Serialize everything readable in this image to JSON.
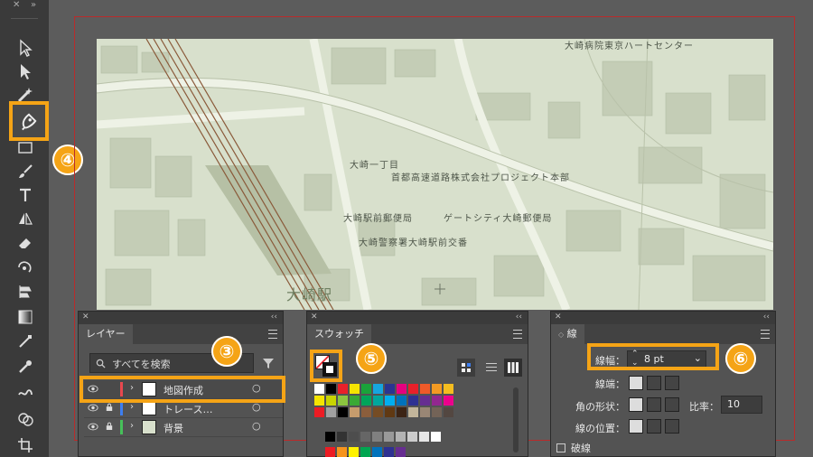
{
  "toolbar": {
    "close": "✕",
    "collapse": "»",
    "badge": "④"
  },
  "map": {
    "labels": [
      "大崎病院東京ハートセンター",
      "大崎一丁目",
      "首都高速道路株式会社プロジェクト本部",
      "大崎駅前郵便局",
      "ゲートシティ大崎郵便局",
      "大崎警察署大崎駅前交番"
    ],
    "station": "大崎駅",
    "colors": {
      "bg": "#d8e0cc",
      "block": "#c4cdb6",
      "road": "#eef2e6",
      "rail": "#8a5a3a"
    }
  },
  "layers": {
    "header_close": "✕",
    "header_collapse": "‹‹",
    "tab": "レイヤー",
    "search_placeholder": "すべてを検索",
    "badge": "③",
    "rows": [
      {
        "name": "地図作成",
        "color": "#e8484e"
      },
      {
        "name": "トレース…",
        "color": "#3d7ef0"
      },
      {
        "name": "背景",
        "color": "#46c05a"
      }
    ]
  },
  "swatches": {
    "header_close": "✕",
    "header_collapse": "‹‹",
    "tab": "スウォッチ",
    "badge": "⑤",
    "row1": [
      "#ffffff",
      "#000000",
      "#e8202a",
      "#f5e400",
      "#1aa33a",
      "#16a6df",
      "#2b3490",
      "#e5007f",
      "#e8202a",
      "#ef5a29",
      "#f39a23",
      "#f5bd1f"
    ],
    "row2": [
      "#f5e400",
      "#c8d400",
      "#8bc53f",
      "#3aa935",
      "#00a55a",
      "#00a79d",
      "#00aeef",
      "#0072bc",
      "#2e3192",
      "#662d91",
      "#92278f",
      "#ec008c"
    ],
    "row3": [
      "#ed1c24",
      "#a0a0a0",
      "#000000",
      "#c69c6d",
      "#8b5e3c",
      "#754c24",
      "#603913",
      "#3c2415",
      "#c2b59b",
      "#998675",
      "#736357",
      "#534741"
    ],
    "grays": [
      "#000000",
      "#333333",
      "#4d4d4d",
      "#666666",
      "#808080",
      "#999999",
      "#b3b3b3",
      "#cccccc",
      "#e6e6e6",
      "#ffffff"
    ],
    "row5": [
      "#ed1c24",
      "#f7941d",
      "#fff200",
      "#00a651",
      "#0072bc",
      "#2e3192",
      "#662d91"
    ]
  },
  "stroke": {
    "header_close": "✕",
    "header_collapse": "‹‹",
    "tab": "線",
    "badge": "⑥",
    "weight_label": "線幅：",
    "weight_value": "8 pt",
    "cap_label": "線端：",
    "corner_label": "角の形状：",
    "ratio_label": "比率：",
    "ratio_value": "10",
    "align_label": "線の位置：",
    "dashed_label": "破線"
  }
}
